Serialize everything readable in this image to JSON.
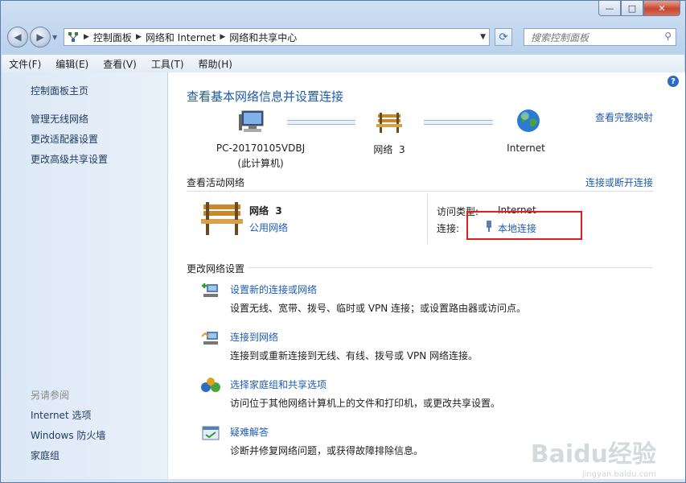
{
  "window": {
    "minimize": "—",
    "maximize": "□",
    "close": "✕"
  },
  "nav": {
    "back_icon": "back-arrow-icon",
    "forward_icon": "forward-arrow-icon",
    "breadcrumbs": [
      "控制面板",
      "网络和 Internet",
      "网络和共享中心"
    ],
    "search_placeholder": "搜索控制面板"
  },
  "menu": [
    "文件(F)",
    "编辑(E)",
    "查看(V)",
    "工具(T)",
    "帮助(H)"
  ],
  "sidebar": {
    "home": "控制面板主页",
    "links": [
      "管理无线网络",
      "更改适配器设置",
      "更改高级共享设置"
    ],
    "see_also_title": "另请参阅",
    "see_also": [
      "Internet 选项",
      "Windows 防火墙",
      "家庭组"
    ]
  },
  "main": {
    "title": "查看基本网络信息并设置连接",
    "full_map_link": "查看完整映射",
    "map": {
      "computer_name": "PC-20170105VDBJ",
      "computer_note": "(此计算机)",
      "network_name": "网络  3",
      "internet_label": "Internet"
    },
    "active_header": "查看活动网络",
    "connect_disconnect_link": "连接或断开连接",
    "active": {
      "network_name": "网络  3",
      "network_type": "公用网络",
      "access_type_label": "访问类型:",
      "access_type_value": "Internet",
      "connections_label": "连接:",
      "connection_link": "本地连接"
    },
    "change_header": "更改网络设置",
    "tasks": [
      {
        "link": "设置新的连接或网络",
        "desc": "设置无线、宽带、拨号、临时或 VPN 连接；或设置路由器或访问点。"
      },
      {
        "link": "连接到网络",
        "desc": "连接到或重新连接到无线、有线、拨号或 VPN 网络连接。"
      },
      {
        "link": "选择家庭组和共享选项",
        "desc": "访问位于其他网络计算机上的文件和打印机，或更改共享设置。"
      },
      {
        "link": "疑难解答",
        "desc": "诊断并修复网络问题，或获得故障排除信息。"
      }
    ]
  },
  "watermark": {
    "brand": "Baidu经验",
    "url": "jingyan.baidu.com"
  }
}
